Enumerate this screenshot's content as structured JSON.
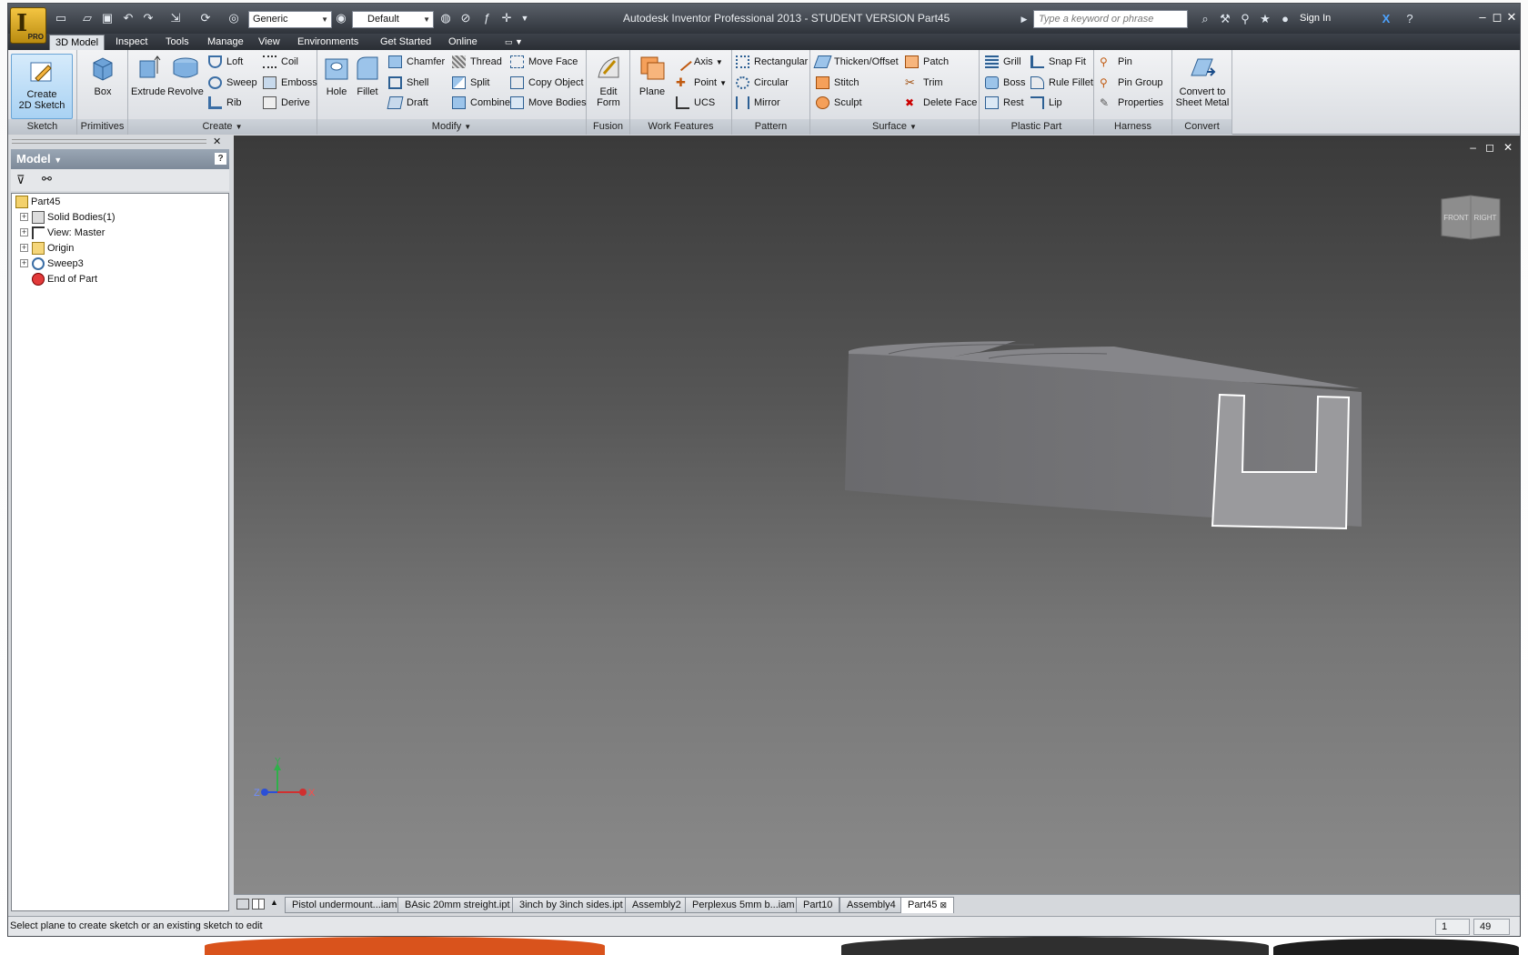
{
  "app": {
    "title": "Autodesk Inventor Professional 2013 - STUDENT VERSION   Part45",
    "pro_badge": "PRO",
    "material_combo": "Generic",
    "appearance_combo": "Default",
    "search_placeholder": "Type a keyword or phrase",
    "sign_in": "Sign In"
  },
  "tabs": [
    "3D Model",
    "Inspect",
    "Tools",
    "Manage",
    "View",
    "Environments",
    "Get Started",
    "Online"
  ],
  "ribbon": {
    "sketch": {
      "title": "Sketch",
      "create": "Create",
      "create2": "2D Sketch"
    },
    "primitives": {
      "title": "Primitives",
      "box": "Box"
    },
    "create": {
      "title": "Create",
      "extrude": "Extrude",
      "revolve": "Revolve",
      "loft": "Loft",
      "sweep": "Sweep",
      "rib": "Rib",
      "coil": "Coil",
      "emboss": "Emboss",
      "derive": "Derive"
    },
    "modify": {
      "title": "Modify",
      "hole": "Hole",
      "fillet": "Fillet",
      "chamfer": "Chamfer",
      "shell": "Shell",
      "draft": "Draft",
      "thread": "Thread",
      "split": "Split",
      "combine": "Combine",
      "move_face": "Move Face",
      "copy_object": "Copy Object",
      "move_bodies": "Move Bodies"
    },
    "fusion": {
      "title": "Fusion",
      "edit": "Edit",
      "form": "Form"
    },
    "work_features": {
      "title": "Work Features",
      "plane": "Plane",
      "axis": "Axis",
      "point": "Point",
      "ucs": "UCS"
    },
    "pattern": {
      "title": "Pattern",
      "rectangular": "Rectangular",
      "circular": "Circular",
      "mirror": "Mirror"
    },
    "surface": {
      "title": "Surface",
      "thicken": "Thicken/Offset",
      "stitch": "Stitch",
      "sculpt": "Sculpt",
      "patch": "Patch",
      "trim": "Trim",
      "delete_face": "Delete Face"
    },
    "plastic": {
      "title": "Plastic Part",
      "grill": "Grill",
      "boss": "Boss",
      "rest": "Rest",
      "snap_fit": "Snap Fit",
      "rule_fillet": "Rule Fillet",
      "lip": "Lip"
    },
    "harness": {
      "title": "Harness",
      "pin": "Pin",
      "pin_group": "Pin Group",
      "properties": "Properties"
    },
    "convert": {
      "title": "Convert",
      "line1": "Convert to",
      "line2": "Sheet Metal"
    }
  },
  "browser": {
    "header": "Model",
    "tree": [
      "Part45",
      "Solid Bodies(1)",
      "View: Master",
      "Origin",
      "Sweep3",
      "End of Part"
    ]
  },
  "viewcube": {
    "front": "FRONT",
    "right": "RIGHT"
  },
  "triad": {
    "x": "X",
    "y": "Y",
    "z": "Z"
  },
  "doc_tabs": [
    "Pistol undermount...iam",
    "BAsic 20mm streight.ipt",
    "3inch by 3inch sides.ipt",
    "Assembly2",
    "Perplexus 5mm b...iam",
    "Part10",
    "Assembly4",
    "Part45"
  ],
  "status": {
    "text": "Select plane to create sketch or an existing sketch to edit",
    "field1": "1",
    "field2": "49"
  },
  "colors": {
    "titlebar": "#3a3f46",
    "viewport_top": "#3a3a3a",
    "viewport_bottom": "#8a8a8a",
    "accent": "#a9d2f3"
  }
}
